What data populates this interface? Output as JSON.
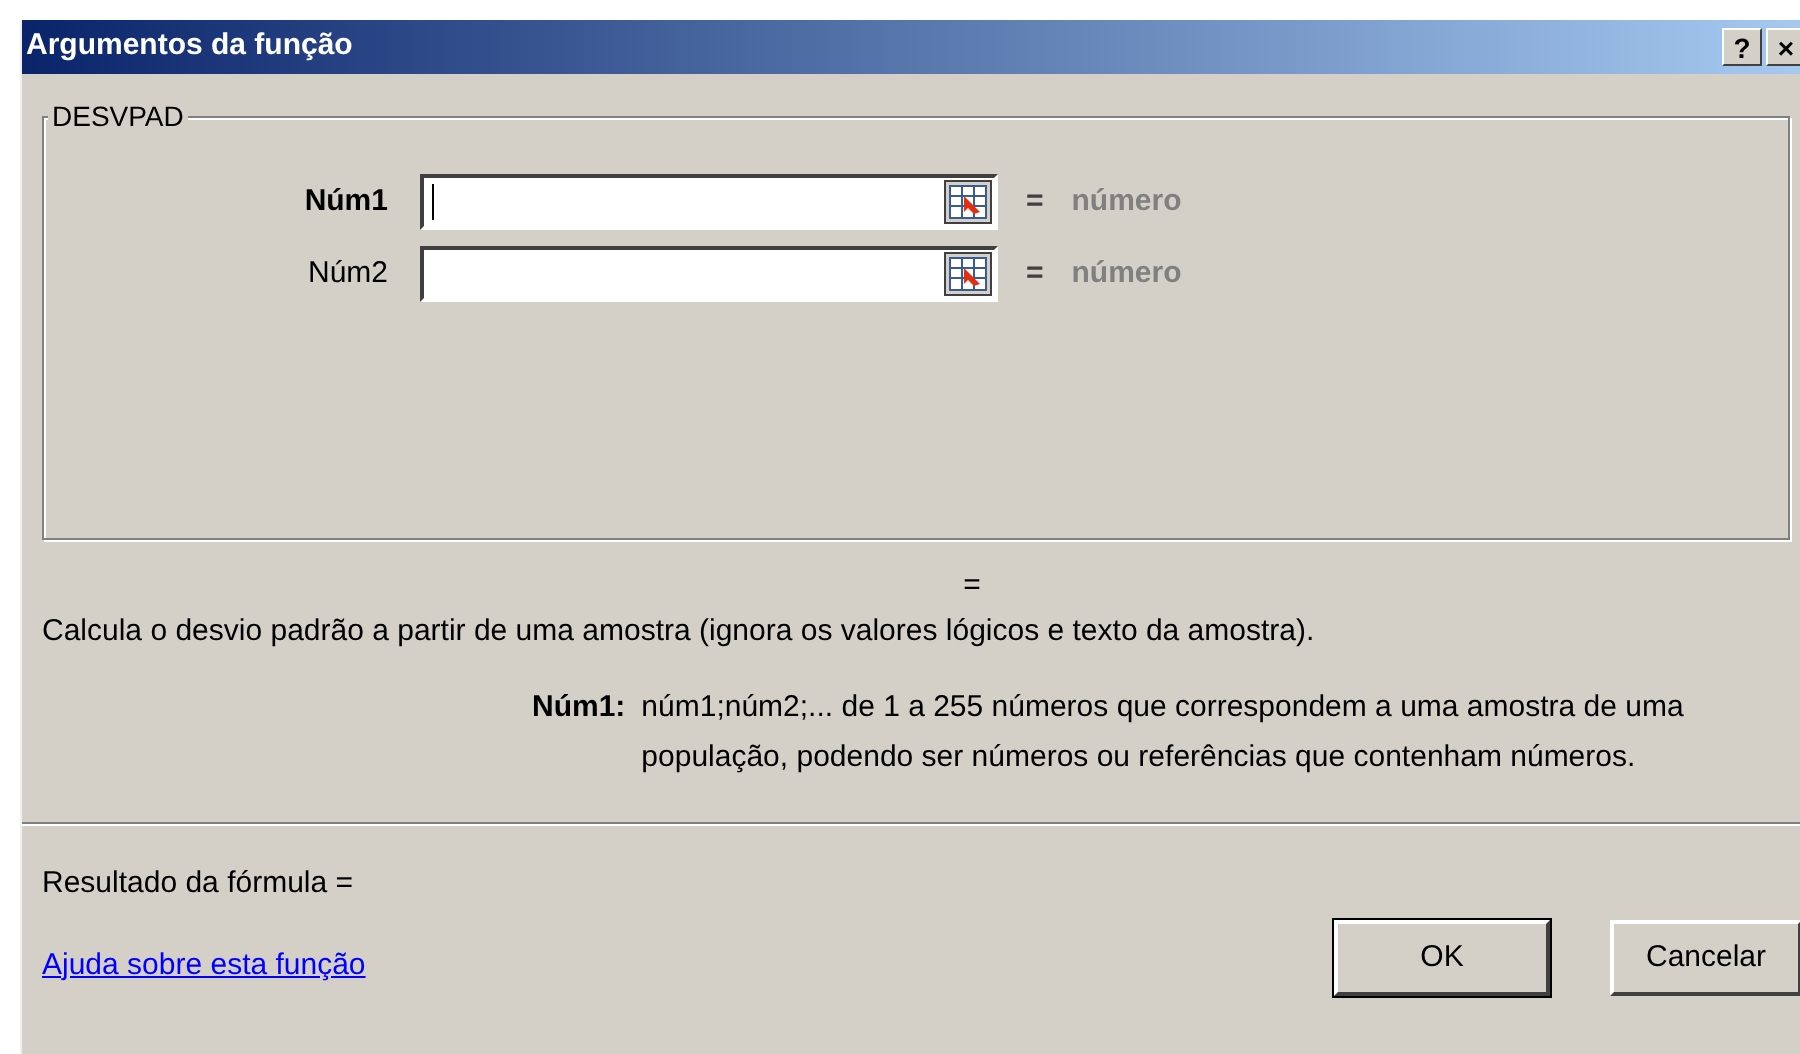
{
  "window": {
    "title": "Argumentos da função",
    "buttons": [
      "?",
      "×"
    ]
  },
  "group": {
    "title": "DESVPAD",
    "arguments": [
      {
        "label": "Núm1",
        "active": true,
        "equals": "=",
        "result": "número"
      },
      {
        "label": "Núm2",
        "active": false,
        "equals": "=",
        "result": "número"
      }
    ]
  },
  "function_result": "=",
  "description": "Calcula o desvio padrão a partir de uma amostra (ignora os valores lógicos e texto da amostra).",
  "argument_help": {
    "label": "Núm1:",
    "text": "núm1;núm2;... de 1 a 255 números que correspondem a uma amostra de uma população, podendo ser números ou referências que contenham números."
  },
  "formula_result": "Resultado da fórmula =",
  "help_link": "Ajuda sobre esta função",
  "buttons": [
    "OK",
    "Cancelar"
  ]
}
